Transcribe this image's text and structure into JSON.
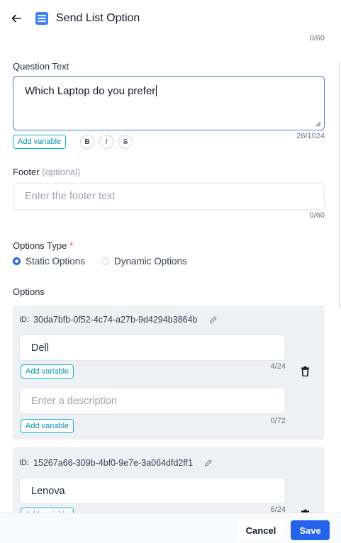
{
  "header": {
    "title": "Send List Option",
    "back_icon": "arrow-left-icon",
    "node_icon": "list-icon",
    "node_icon_color": "#3b82f6"
  },
  "top_counter": "0/60",
  "question": {
    "label": "Question Text",
    "value": "Which Laptop do you prefer",
    "counter": "26/1024",
    "add_variable": "Add variable",
    "format_buttons": [
      "B",
      "I",
      "S"
    ]
  },
  "footer_field": {
    "label": "Footer",
    "optional": "(optional)",
    "placeholder": "Enter the footer text",
    "counter": "0/60"
  },
  "options_type": {
    "label": "Options Type",
    "required_mark": "*",
    "choices": [
      "Static Options",
      "Dynamic Options"
    ],
    "selected": "Static Options"
  },
  "options": {
    "label": "Options",
    "id_label": "ID:",
    "items": [
      {
        "id": "30da7bfb-0f52-4c74-a27b-9d4294b3864b",
        "title": "Dell",
        "title_counter": "4/24",
        "add_variable": "Add variable",
        "description_placeholder": "Enter a description",
        "description_counter": "0/72"
      },
      {
        "id": "15267a66-309b-4bf0-9e7e-3a064dfd2ff1",
        "title": "Lenova",
        "title_counter": "6/24",
        "add_variable": "Add variable"
      }
    ]
  },
  "actions": {
    "cancel": "Cancel",
    "save": "Save"
  },
  "colors": {
    "accent": "#2563eb",
    "variable": "#0891b2",
    "required": "#ef4444"
  }
}
